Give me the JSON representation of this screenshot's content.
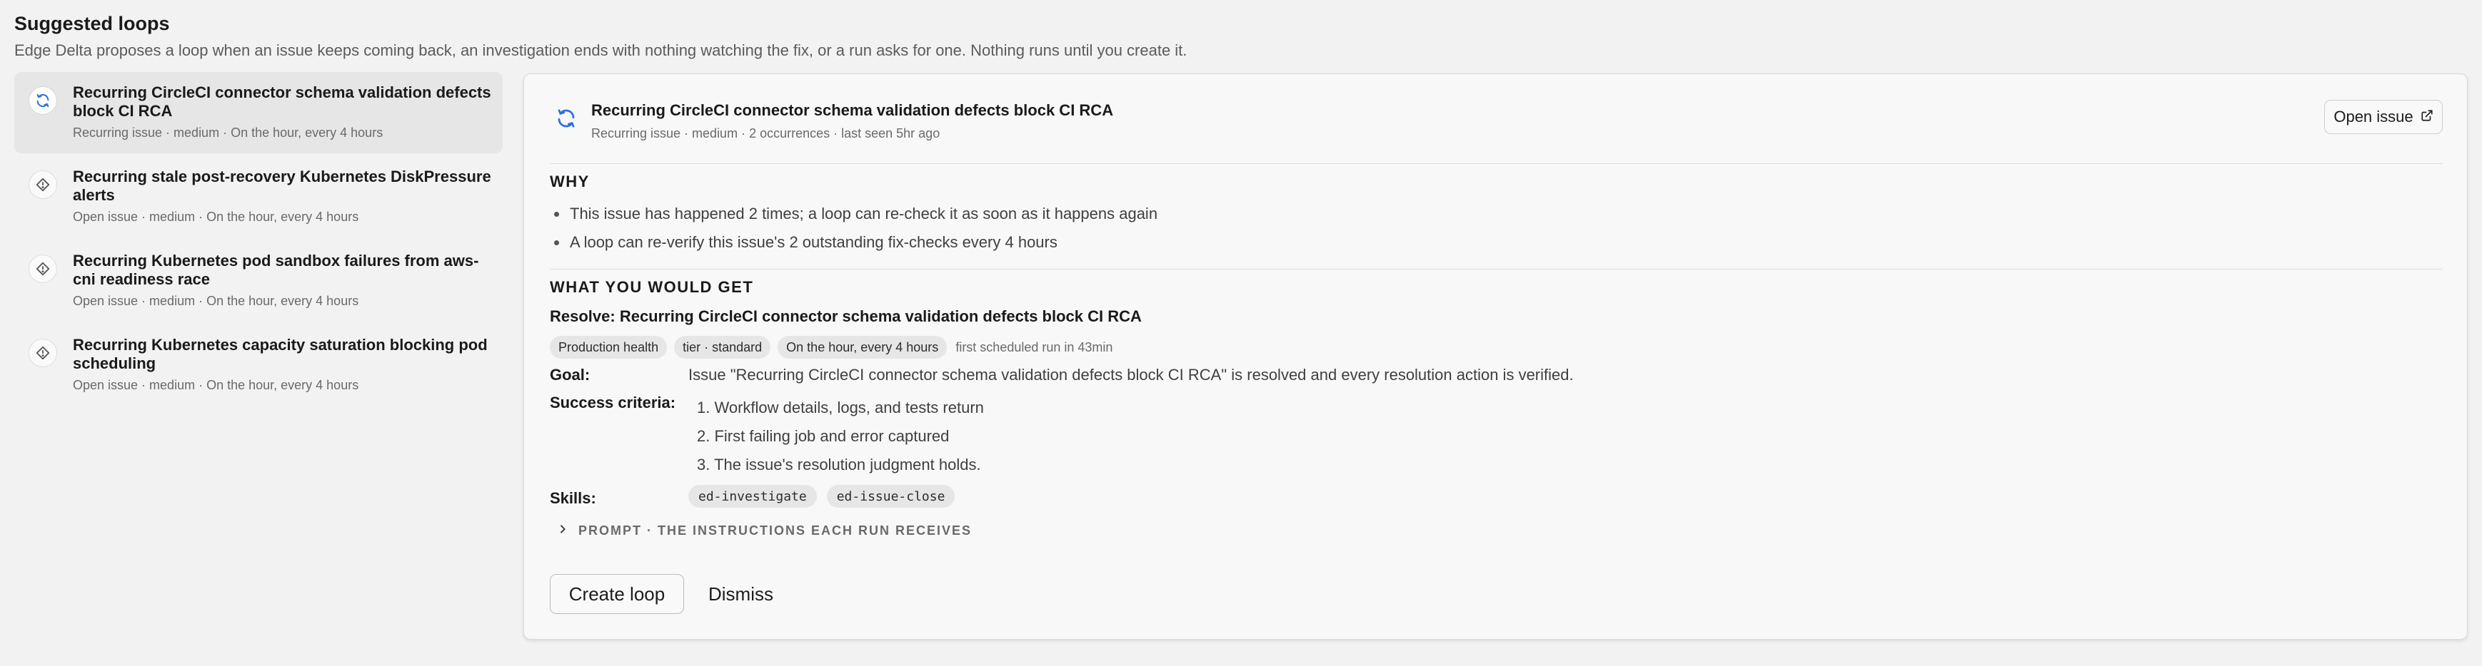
{
  "page": {
    "title": "Suggested loops",
    "description": "Edge Delta proposes a loop when an issue keeps coming back, an investigation ends with nothing watching the fix, or a run asks for one. Nothing runs until you create it."
  },
  "suggestions": [
    {
      "title": "Recurring CircleCI connector schema validation defects block CI RCA",
      "meta": "Recurring issue · medium · On the hour, every 4 hours",
      "icon": "refresh-icon",
      "selected": true
    },
    {
      "title": "Recurring stale post-recovery Kubernetes DiskPressure alerts",
      "meta": "Open issue · medium · On the hour, every 4 hours",
      "icon": "diamond-alert-icon"
    },
    {
      "title": "Recurring Kubernetes pod sandbox failures from aws-cni readiness race",
      "meta": "Open issue · medium · On the hour, every 4 hours",
      "icon": "diamond-alert-icon"
    },
    {
      "title": "Recurring Kubernetes capacity saturation blocking pod scheduling",
      "meta": "Open issue · medium · On the hour, every 4 hours",
      "icon": "diamond-alert-icon"
    }
  ],
  "detail": {
    "title": "Recurring CircleCI connector schema validation defects block CI RCA",
    "meta": "Recurring issue · medium · 2 occurrences · last seen 5hr ago",
    "open_issue_label": "Open issue",
    "why_title": "WHY",
    "why": [
      "This issue has happened 2 times; a loop can re-check it as soon as it happens again",
      "A loop can re-verify this issue's 2 outstanding fix-checks every 4 hours"
    ],
    "get_title": "WHAT YOU WOULD GET",
    "resolve_title": "Resolve: Recurring CircleCI connector schema validation defects block CI RCA",
    "chips": [
      "Production health",
      "tier · standard",
      "On the hour, every 4 hours"
    ],
    "chip_note": "first scheduled run in 43min",
    "goal_label": "Goal:",
    "goal": "Issue \"Recurring CircleCI connector schema validation defects block CI RCA\" is resolved and every resolution action is verified.",
    "criteria_label": "Success criteria:",
    "criteria": [
      "1. Workflow details, logs, and tests return",
      "2. First failing job and error captured",
      "3. The issue's resolution judgment holds."
    ],
    "skills_label": "Skills:",
    "skills": [
      "ed-investigate",
      "ed-issue-close"
    ],
    "prompt_label": "PROMPT · THE INSTRUCTIONS EACH RUN RECEIVES",
    "create_label": "Create loop",
    "dismiss_label": "Dismiss"
  },
  "colors": {
    "accent_icon": "#2e6fe0",
    "panel_bg": "#f8f8f8",
    "selected_bg": "#e6e6e6"
  }
}
